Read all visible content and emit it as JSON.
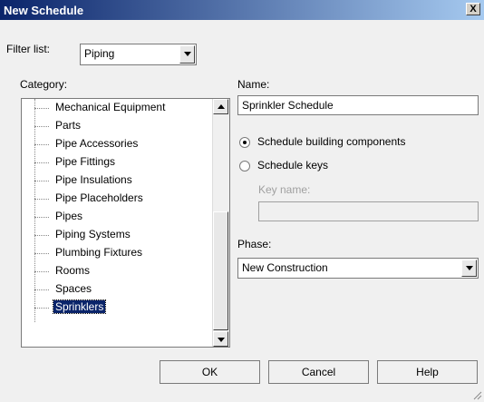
{
  "window": {
    "title": "New Schedule",
    "close_glyph": "X"
  },
  "filter": {
    "label": "Filter list:",
    "value": "Piping"
  },
  "category": {
    "label": "Category:",
    "items": [
      "Mechanical Equipment",
      "Parts",
      "Pipe Accessories",
      "Pipe Fittings",
      "Pipe Insulations",
      "Pipe Placeholders",
      "Pipes",
      "Piping Systems",
      "Plumbing Fixtures",
      "Rooms",
      "Spaces",
      "Sprinklers"
    ],
    "selected": "Sprinklers"
  },
  "name": {
    "label": "Name:",
    "value": "Sprinkler Schedule"
  },
  "schedule_type": {
    "building_components": "Schedule building components",
    "keys": "Schedule keys",
    "selected": "building_components"
  },
  "key_name": {
    "label": "Key name:",
    "value": ""
  },
  "phase": {
    "label": "Phase:",
    "value": "New Construction"
  },
  "buttons": {
    "ok": "OK",
    "cancel": "Cancel",
    "help": "Help"
  }
}
